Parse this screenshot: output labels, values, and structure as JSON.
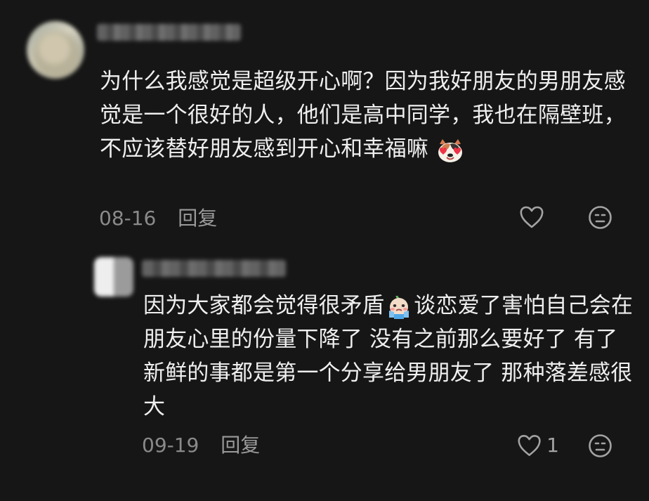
{
  "comment": {
    "text": "为什么我感觉是超级开心啊？因为我好朋友的男朋友感觉是一个很好的人，他们是高中同学，我也在隔壁班，不应该替好朋友感到开心和幸福嘛",
    "date": "08-16",
    "reply_label": "回复",
    "emoji": "heart-eyes-cat"
  },
  "reply": {
    "text_before": "因为大家都会觉得很矛盾",
    "text_after": "谈恋爱了害怕自己会在朋友心里的份量下降了 没有之前那么要好了 有了新鲜的事都是第一个分享给男朋友了 那种落差感很大",
    "date": "09-19",
    "reply_label": "回复",
    "like_count": "1",
    "emoji": "worried-baby"
  }
}
